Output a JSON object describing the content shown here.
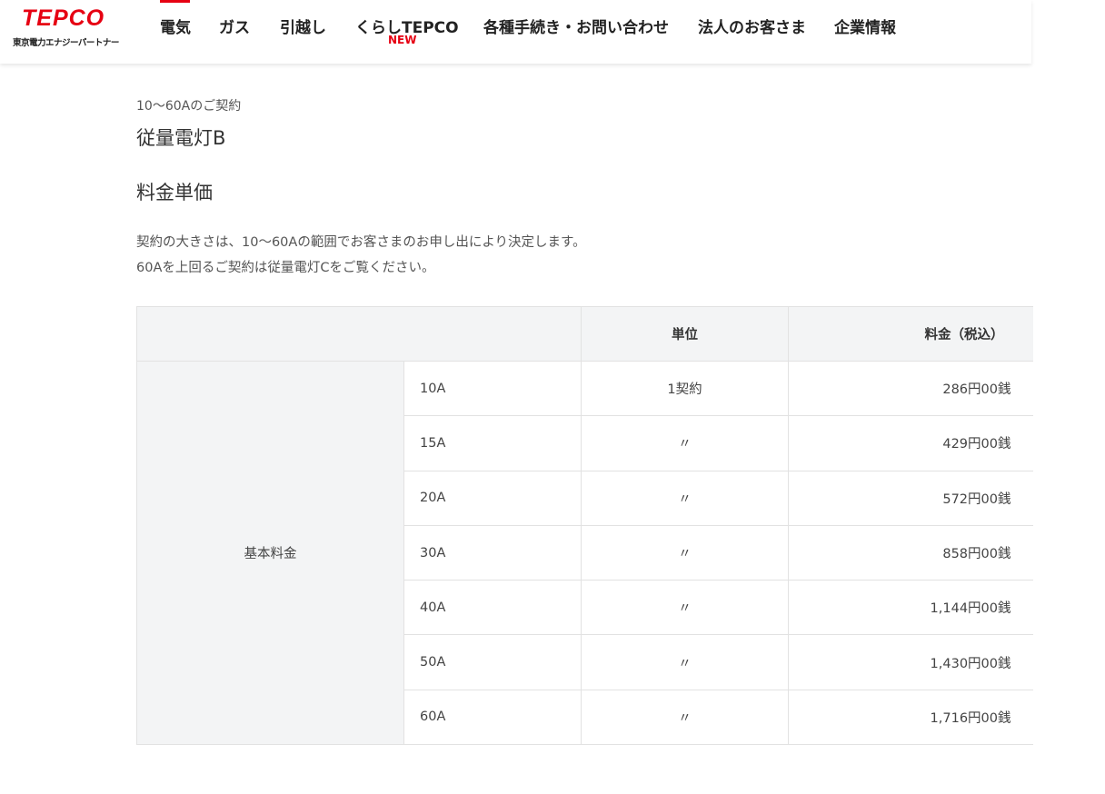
{
  "header": {
    "logo": {
      "main": "TEPCO",
      "sub": "東京電力エナジーパートナー"
    },
    "nav": [
      {
        "label": "電気",
        "active": true
      },
      {
        "label": "ガス"
      },
      {
        "label": "引越し"
      },
      {
        "label": "くらしTEPCO",
        "badge": "NEW"
      },
      {
        "label": "各種手続き・お問い合わせ"
      },
      {
        "label": "法人のお客さま"
      },
      {
        "label": "企業情報"
      }
    ]
  },
  "content": {
    "pre_title": "10〜60Aのご契約",
    "plan_title": "従量電灯B",
    "section_title": "料金単価",
    "description": [
      "契約の大きさは、10〜60Aの範囲でお客さまのお申し出により決定します。",
      "60Aを上回るご契約は従量電灯Cをご覧ください。"
    ]
  },
  "table": {
    "headers": {
      "unit": "単位",
      "price": "料金（税込）"
    },
    "row_group": "基本料金",
    "rows": [
      {
        "amp": "10A",
        "unit": "1契約",
        "price": "286円00銭"
      },
      {
        "amp": "15A",
        "unit": "〃",
        "price": "429円00銭"
      },
      {
        "amp": "20A",
        "unit": "〃",
        "price": "572円00銭"
      },
      {
        "amp": "30A",
        "unit": "〃",
        "price": "858円00銭"
      },
      {
        "amp": "40A",
        "unit": "〃",
        "price": "1,144円00銭"
      },
      {
        "amp": "50A",
        "unit": "〃",
        "price": "1,430円00銭"
      },
      {
        "amp": "60A",
        "unit": "〃",
        "price": "1,716円00銭"
      }
    ]
  },
  "colors": {
    "brand": "#e60012",
    "table_header_bg": "#f3f4f5",
    "border": "#e2e2e2"
  }
}
